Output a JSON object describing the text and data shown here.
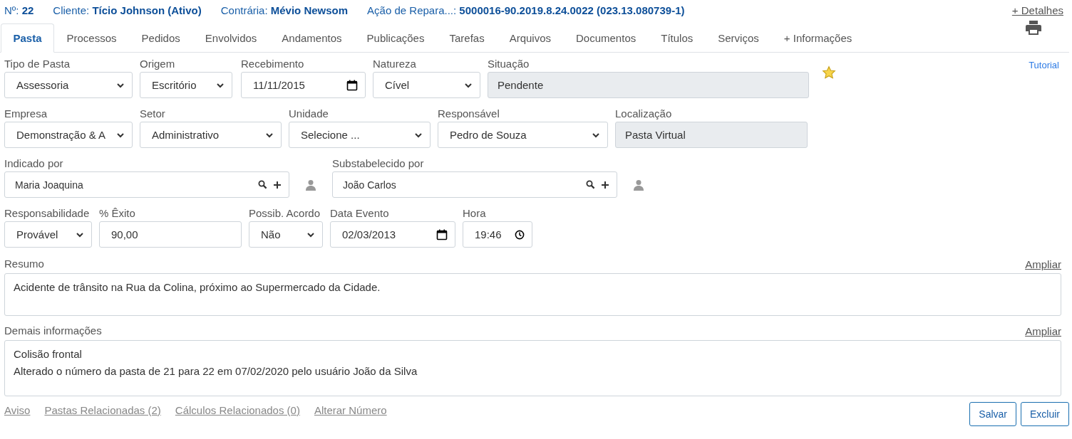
{
  "header": [
    {
      "label": "Nº:",
      "value": "22"
    },
    {
      "label": "Cliente:",
      "value": "Tício Johnson (Ativo)"
    },
    {
      "label": "Contrária:",
      "value": "Mévio Newsom"
    },
    {
      "label": "Ação de Repara...:",
      "value": "5000016-90.2019.8.24.0022 (023.13.080739-1)"
    }
  ],
  "details_link": "+ Detalhes",
  "tabs": [
    {
      "label": "Pasta",
      "selected": true
    },
    {
      "label": "Processos",
      "selected": false
    },
    {
      "label": "Pedidos",
      "selected": false
    },
    {
      "label": "Envolvidos",
      "selected": false
    },
    {
      "label": "Andamentos",
      "selected": false
    },
    {
      "label": "Publicações",
      "selected": false
    },
    {
      "label": "Tarefas",
      "selected": false
    },
    {
      "label": "Arquivos",
      "selected": false
    },
    {
      "label": "Documentos",
      "selected": false
    },
    {
      "label": "Títulos",
      "selected": false
    },
    {
      "label": "Serviços",
      "selected": false
    },
    {
      "label": "+ Informações",
      "selected": false
    }
  ],
  "tutorial_link": "Tutorial",
  "rows": [
    [
      {
        "kind": "select",
        "label": "Tipo de Pasta",
        "value": "Assessoria"
      },
      {
        "kind": "select",
        "label": "Origem",
        "value": "Escritório"
      },
      {
        "kind": "date",
        "label": "Recebimento",
        "value": "11/11/2015"
      },
      {
        "kind": "select",
        "label": "Natureza",
        "value": "Cível"
      },
      {
        "kind": "readonly",
        "label": "Situação",
        "value": "Pendente"
      },
      {
        "kind": "star"
      }
    ],
    [
      {
        "kind": "select",
        "label": "Empresa",
        "value": "Demonstração & A"
      },
      {
        "kind": "select",
        "label": "Setor",
        "value": "Administrativo"
      },
      {
        "kind": "select",
        "label": "Unidade",
        "value": "Selecione ..."
      },
      {
        "kind": "select",
        "label": "Responsável",
        "value": "Pedro de Souza"
      },
      {
        "kind": "readonly",
        "label": "Localização",
        "value": "Pasta Virtual"
      }
    ],
    [
      {
        "kind": "lookup",
        "label": "Indicado por",
        "value": "Maria Joaquina"
      },
      {
        "kind": "person"
      },
      {
        "kind": "lookup",
        "label": "Substabelecido por",
        "value": "João Carlos"
      },
      {
        "kind": "person"
      }
    ],
    [
      {
        "kind": "select",
        "label": "Responsabilidade",
        "value": "Provável"
      },
      {
        "kind": "text",
        "label": "% Êxito",
        "value": "90,00"
      },
      {
        "kind": "select",
        "label": "Possib. Acordo",
        "value": "Não"
      },
      {
        "kind": "date",
        "label": "Data Evento",
        "value": "02/03/2013"
      },
      {
        "kind": "time",
        "label": "Hora",
        "value": "19:46"
      }
    ]
  ],
  "textareas": [
    {
      "label": "Resumo",
      "link": "Ampliar",
      "value": "Acidente de trânsito na Rua da Colina, próximo ao Supermercado da Cidade."
    },
    {
      "label": "Demais informações",
      "link": "Ampliar",
      "value": "Colisão frontal\nAlterado o número da pasta de 21 para 22 em 07/02/2020 pelo usuário João da Silva"
    }
  ],
  "footer_links": [
    "Aviso",
    "Pastas Relacionadas (2)",
    "Cálculos Relacionados (0)",
    "Alterar Número"
  ],
  "buttons": [
    "Salvar",
    "Excluir"
  ]
}
